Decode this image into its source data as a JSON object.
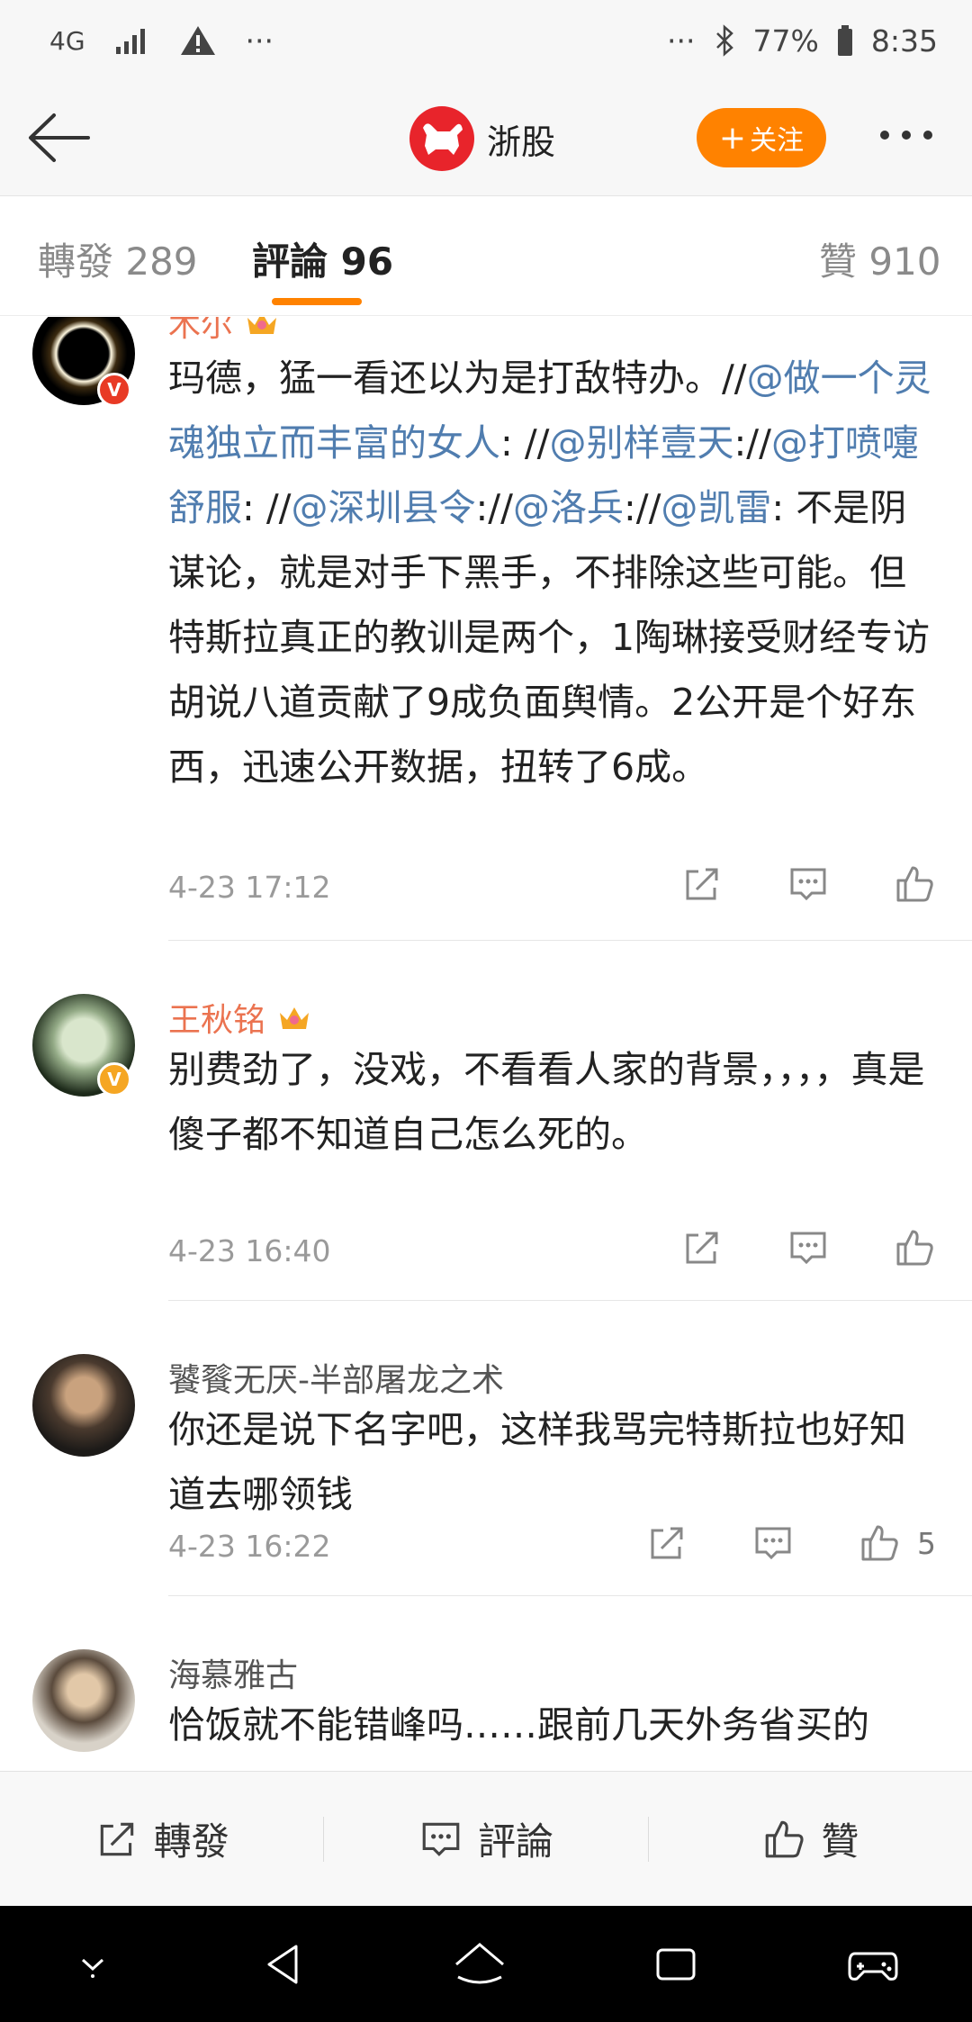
{
  "status_bar": {
    "network": "4G",
    "overflow_left": "···",
    "overflow_right": "···",
    "battery": "77%",
    "time": "8:35"
  },
  "header": {
    "account_name": "浙股",
    "follow_label": "关注",
    "follow_plus": "+"
  },
  "tabs": {
    "repost": "轉發 289",
    "comments": "評論 96",
    "likes": "贊 910"
  },
  "comments": [
    {
      "name": "木尔",
      "text_parts": [
        "玛德，猛一看还以为是打敌特办。//",
        "@做一个灵魂独立而丰富的女人",
        ": //",
        "@别样壹天",
        "://",
        "@打喷嚏舒服",
        ": //",
        "@深圳县令",
        "://",
        "@洛兵",
        "://",
        "@凯雷",
        ": 不是阴谋论，就是对手下黑手，不排除这些可能。但特斯拉真正的教训是两个，1陶琳接受财经专访胡说八道贡献了9成负面舆情。2公开是个好东西，迅速公开数据，扭转了6成。"
      ],
      "time": "4-23 17:12",
      "likes": ""
    },
    {
      "name": "王秋铭",
      "text": "别费劲了，没戏，不看看人家的背景，，，，真是傻子都不知道自己怎么死的。",
      "time": "4-23 16:40",
      "likes": ""
    },
    {
      "name": "饕餮无厌-半部屠龙之术",
      "text": "你还是说下名字吧，这样我骂完特斯拉也好知道去哪领钱",
      "time": "4-23 16:22",
      "likes": "5"
    },
    {
      "name": "海慕雅古",
      "text": "恰饭就不能错峰吗……跟前几天外务省买的"
    }
  ],
  "bottom_bar": {
    "repost": "轉發",
    "comment": "評論",
    "like": "贊"
  },
  "colors": {
    "accent": "#ff8200",
    "link": "#507daf",
    "vip_name": "#eb7350",
    "brand_red": "#e8242b"
  }
}
